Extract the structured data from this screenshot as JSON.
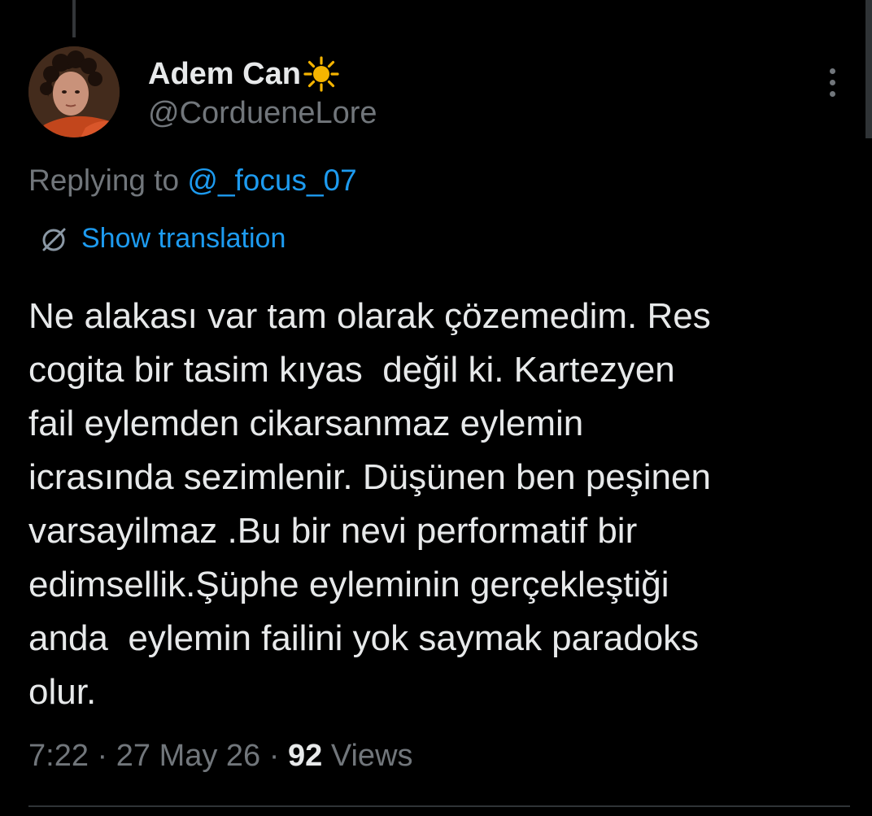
{
  "tweet": {
    "author": {
      "display_name": "Adem Can",
      "emoji_icon": "sun-icon",
      "handle": "@CordueneLore",
      "avatar_icon": "profile-avatar"
    },
    "replying_prefix": "Replying to",
    "replying_to": "@_focus_07",
    "translate_label": "Show translation",
    "body_lines": [
      "Ne alakası var tam olarak çözemedim. Res",
      "cogita bir tasim kıyas  değil ki. Kartezyen",
      "fail eylemden cikarsanmaz eylemin",
      "icrasında sezimlenir. Düşünen ben peşinen",
      "varsayilmaz .Bu bir nevi performatif bir",
      "edimsellik.Şüphe eyleminin gerçekleştiği",
      "anda  eylemin failini yok saymak paradoks",
      "olur."
    ],
    "time": "7:22",
    "separator": "·",
    "date": "27 May 26",
    "views_count": "92",
    "views_label": "Views"
  },
  "colors": {
    "background": "#000000",
    "text_primary": "#e7e9ea",
    "text_secondary": "#71767b",
    "accent": "#1d9bf0",
    "sun": "#f5b400"
  }
}
